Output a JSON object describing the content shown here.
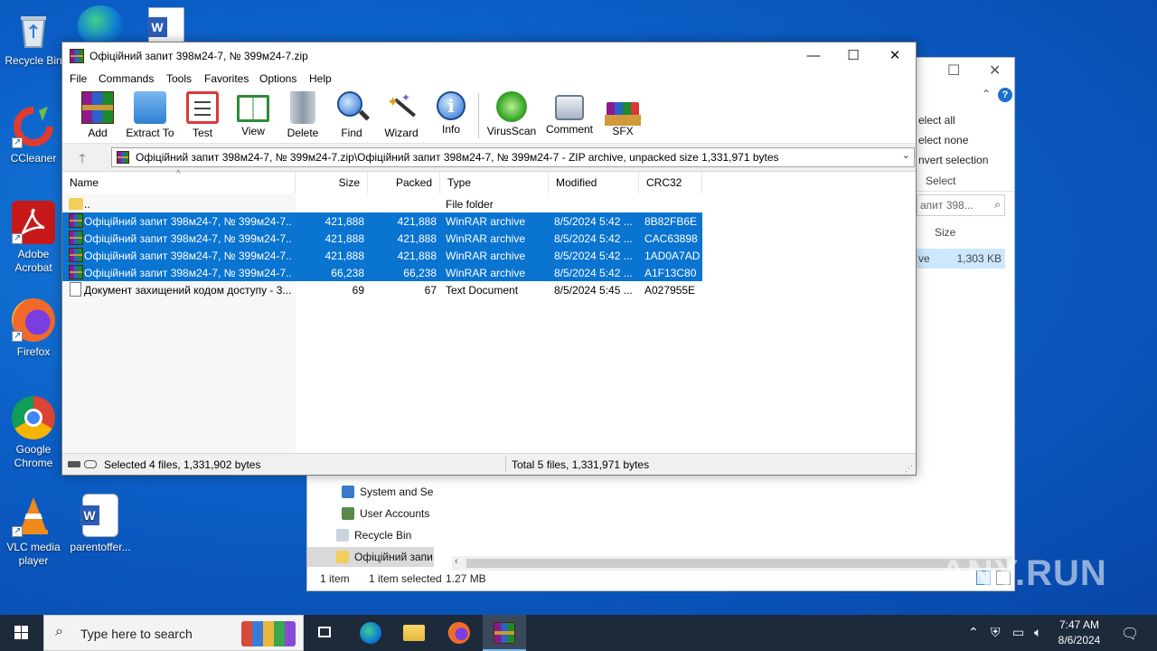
{
  "desktop": {
    "icons": [
      {
        "label": "Recycle Bin",
        "icon": "recycle-bin-icon"
      },
      {
        "label": "CCleaner",
        "icon": "ccleaner-icon"
      },
      {
        "label": "Adobe Acrobat",
        "icon": "acrobat-icon"
      },
      {
        "label": "Firefox",
        "icon": "firefox-icon"
      },
      {
        "label": "Google Chrome",
        "icon": "chrome-icon"
      },
      {
        "label": "VLC media player",
        "icon": "vlc-icon"
      },
      {
        "label": "parentoffer...",
        "icon": "word-doc-icon"
      }
    ]
  },
  "explorer": {
    "ribbon": {
      "select_all": "elect all",
      "select_none": "elect none",
      "invert": "nvert selection",
      "group": "Select"
    },
    "search_placeholder": "апит 398...",
    "col_size": "Size",
    "selected_row": {
      "type": "ve",
      "size": "1,303 KB"
    },
    "nav": [
      {
        "label": "System and Se",
        "icon": "system-icon"
      },
      {
        "label": "User Accounts",
        "icon": "users-icon"
      },
      {
        "label": "Recycle Bin",
        "icon": "recycle-bin-icon"
      },
      {
        "label": "Офіційний запи",
        "icon": "folder-icon"
      }
    ],
    "status": {
      "count": "1 item",
      "selected": "1 item selected",
      "size": "1.27 MB"
    }
  },
  "winrar": {
    "title": "Офіційний запит 398м24-7, № 399м24-7.zip",
    "menu": [
      "File",
      "Commands",
      "Tools",
      "Favorites",
      "Options",
      "Help"
    ],
    "toolbar": [
      {
        "label": "Add",
        "icon": "add-archive-icon",
        "color": "#c0392b"
      },
      {
        "label": "Extract To",
        "icon": "extract-folder-icon",
        "color": "#2f80d1"
      },
      {
        "label": "Test",
        "icon": "test-checklist-icon",
        "color": "#d83a3a"
      },
      {
        "label": "View",
        "icon": "view-book-icon",
        "color": "#2e8b3a"
      },
      {
        "label": "Delete",
        "icon": "delete-trash-icon",
        "color": "#8a9aa8"
      },
      {
        "label": "Find",
        "icon": "find-magnifier-icon",
        "color": "#2a6fd0"
      },
      {
        "label": "Wizard",
        "icon": "wizard-wand-icon",
        "color": "#7a5ad0"
      },
      {
        "label": "Info",
        "icon": "info-icon",
        "color": "#2a6fd0"
      },
      {
        "label": "VirusScan",
        "icon": "virusscan-bug-icon",
        "color": "#3aa82a"
      },
      {
        "label": "Comment",
        "icon": "comment-icon",
        "color": "#7a8aa0"
      },
      {
        "label": "SFX",
        "icon": "sfx-box-icon",
        "color": "#d09a3a"
      }
    ],
    "address": "Офіційний запит 398м24-7, № 399м24-7.zip\\Офіційний запит 398м24-7, № 399м24-7 - ZIP archive, unpacked size 1,331,971 bytes",
    "columns": [
      "Name",
      "Size",
      "Packed",
      "Type",
      "Modified",
      "CRC32"
    ],
    "rows": [
      {
        "name": "..",
        "size": "",
        "packed": "",
        "type": "File folder",
        "modified": "",
        "crc": "",
        "selected": false,
        "icon": "folder"
      },
      {
        "name": "Офіційний запит 398м24-7, № 399м24-7....",
        "size": "421,888",
        "packed": "421,888",
        "type": "WinRAR archive",
        "modified": "8/5/2024 5:42 ...",
        "crc": "8B82FB6E",
        "selected": true,
        "icon": "rar"
      },
      {
        "name": "Офіційний запит 398м24-7, № 399м24-7....",
        "size": "421,888",
        "packed": "421,888",
        "type": "WinRAR archive",
        "modified": "8/5/2024 5:42 ...",
        "crc": "CAC63898",
        "selected": true,
        "icon": "rar"
      },
      {
        "name": "Офіційний запит 398м24-7, № 399м24-7....",
        "size": "421,888",
        "packed": "421,888",
        "type": "WinRAR archive",
        "modified": "8/5/2024 5:42 ...",
        "crc": "1AD0A7AD",
        "selected": true,
        "icon": "rar"
      },
      {
        "name": "Офіційний запит 398м24-7, № 399м24-7....",
        "size": "66,238",
        "packed": "66,238",
        "type": "WinRAR archive",
        "modified": "8/5/2024 5:42 ...",
        "crc": "A1F13C80",
        "selected": true,
        "icon": "rar"
      },
      {
        "name": "Документ захищений кодом доступу - 3...",
        "size": "69",
        "packed": "67",
        "type": "Text Document",
        "modified": "8/5/2024 5:45 ...",
        "crc": "A027955E",
        "selected": false,
        "icon": "txt"
      }
    ],
    "status_left": "Selected 4 files, 1,331,902 bytes",
    "status_right": "Total 5 files, 1,331,971 bytes"
  },
  "taskbar": {
    "search_placeholder": "Type here to search",
    "time": "7:47 AM",
    "date": "8/6/2024",
    "apps": [
      "task-view-icon",
      "edge-icon",
      "file-explorer-icon",
      "firefox-icon",
      "winrar-icon"
    ]
  },
  "watermark": "ANY.RUN"
}
